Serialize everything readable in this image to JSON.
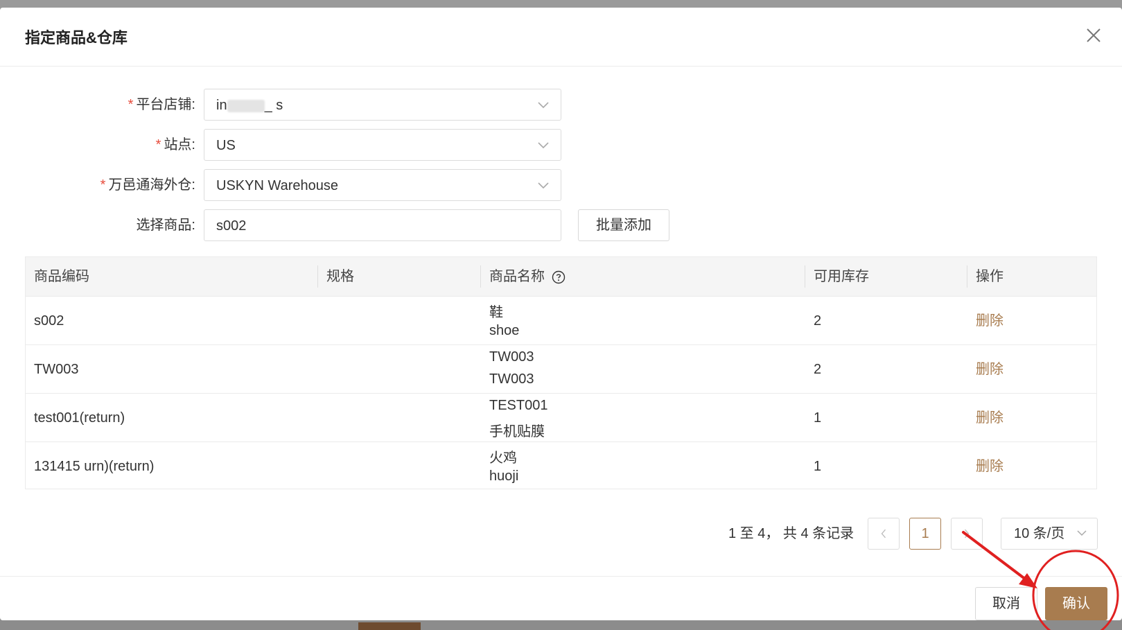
{
  "dialog": {
    "title": "指定商品&仓库"
  },
  "form": {
    "store_label": "平台店铺:",
    "store_value_prefix": "in",
    "store_value_suffix": "_ s",
    "site_label": "站点:",
    "site_value": "US",
    "warehouse_label": "万邑通海外仓:",
    "warehouse_value": "USKYN Warehouse",
    "product_label": "选择商品:",
    "product_value": "s002",
    "batch_add_label": "批量添加",
    "required_mark": "*"
  },
  "table": {
    "headers": {
      "code": "商品编码",
      "spec": "规格",
      "name": "商品名称",
      "stock": "可用库存",
      "action": "操作"
    },
    "rows": [
      {
        "code": "s002",
        "name_line1": "鞋",
        "name_line2": "shoe",
        "stock": "2",
        "action": "删除"
      },
      {
        "code": "TW003",
        "name_line1": "TW003",
        "name_line2": "TW003",
        "stock": "2",
        "action": "删除"
      },
      {
        "code": "test001(return)",
        "name_line1": "TEST001",
        "name_line2": "手机贴膜",
        "stock": "1",
        "action": "删除"
      },
      {
        "code": "131415 urn)(return)",
        "name_line1": "火鸡",
        "name_line2": "huoji",
        "stock": "1",
        "action": "删除"
      }
    ]
  },
  "pagination": {
    "summary": "1 至 4， 共 4 条记录",
    "current_page": "1",
    "page_size": "10 条/页",
    "prev_icon": "chevron-left-icon",
    "next_icon": "chevron-right-icon"
  },
  "footer": {
    "cancel_label": "取消",
    "confirm_label": "确认"
  },
  "colors": {
    "accent": "#a87c4f",
    "required": "#e74c3c",
    "annotation": "#e02020"
  }
}
